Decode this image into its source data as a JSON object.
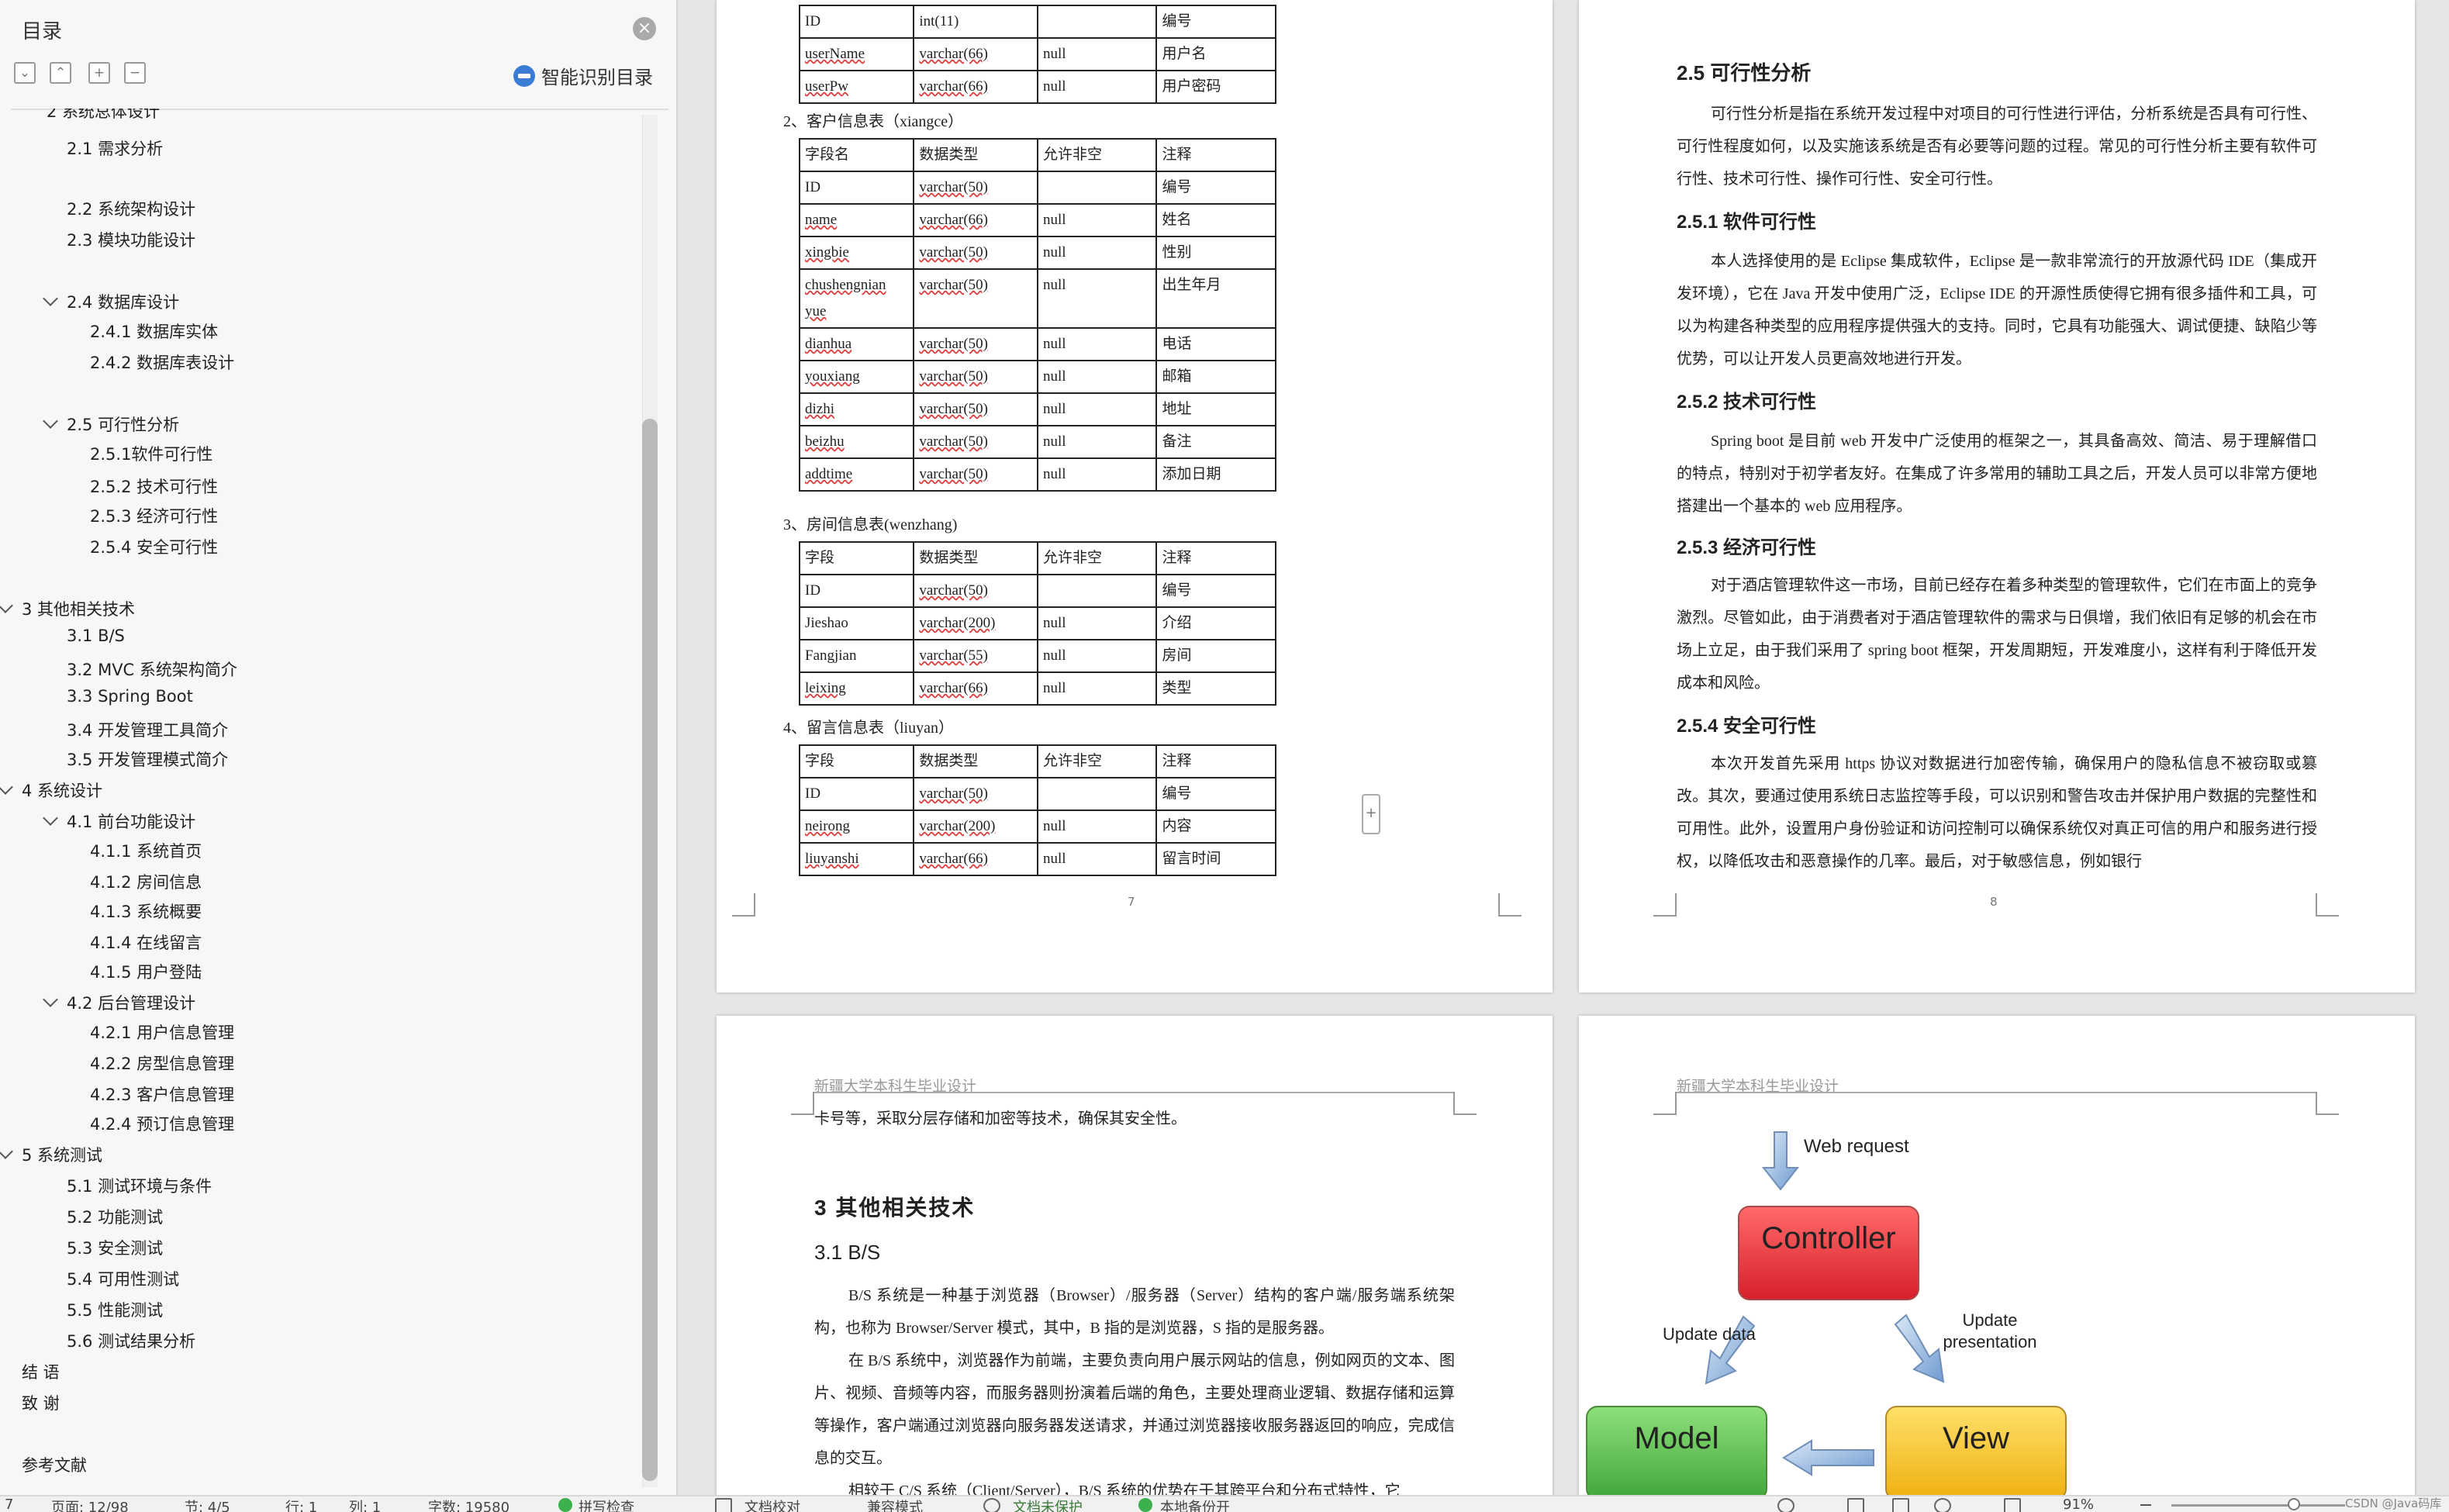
{
  "toc": {
    "title": "目录",
    "smart_label": "智能识别目录",
    "items": [
      {
        "label": "2.1 需求分析",
        "level": 1
      },
      {
        "label": "2.2 系统架构设计",
        "level": 1
      },
      {
        "label": "2.3 模块功能设计",
        "level": 1
      },
      {
        "label": "2.4 数据库设计",
        "level": 1,
        "expanded": true
      },
      {
        "label": "2.4.1 数据库实体",
        "level": 2
      },
      {
        "label": "2.4.2 数据库表设计",
        "level": 2
      },
      {
        "label": "2.5 可行性分析",
        "level": 1,
        "expanded": true
      },
      {
        "label": "2.5.1软件可行性",
        "level": 2
      },
      {
        "label": "2.5.2 技术可行性",
        "level": 2
      },
      {
        "label": "2.5.3 经济可行性",
        "level": 2
      },
      {
        "label": "2.5.4 安全可行性",
        "level": 2
      },
      {
        "label": "3 其他相关技术",
        "level": 0,
        "expanded": true
      },
      {
        "label": "3.1 B/S",
        "level": 1
      },
      {
        "label": "3.2 MVC 系统架构简介",
        "level": 1
      },
      {
        "label": "3.3 Spring Boot",
        "level": 1
      },
      {
        "label": "3.4 开发管理工具简介",
        "level": 1
      },
      {
        "label": "3.5 开发管理模式简介",
        "level": 1
      },
      {
        "label": "4 系统设计",
        "level": 0,
        "expanded": true
      },
      {
        "label": "4.1 前台功能设计",
        "level": 1,
        "expanded": true
      },
      {
        "label": "4.1.1 系统首页",
        "level": 2
      },
      {
        "label": "4.1.2 房间信息",
        "level": 2
      },
      {
        "label": "4.1.3 系统概要",
        "level": 2
      },
      {
        "label": "4.1.4 在线留言",
        "level": 2
      },
      {
        "label": "4.1.5 用户登陆",
        "level": 2
      },
      {
        "label": "4.2 后台管理设计",
        "level": 1,
        "expanded": true
      },
      {
        "label": "4.2.1 用户信息管理",
        "level": 2
      },
      {
        "label": "4.2.2 房型信息管理",
        "level": 2
      },
      {
        "label": "4.2.3 客户信息管理",
        "level": 2
      },
      {
        "label": "4.2.4 预订信息管理",
        "level": 2
      },
      {
        "label": "5 系统测试",
        "level": 0,
        "expanded": true
      },
      {
        "label": "5.1 测试环境与条件",
        "level": 1
      },
      {
        "label": "5.2 功能测试",
        "level": 1
      },
      {
        "label": "5.3 安全测试",
        "level": 1
      },
      {
        "label": "5.4 可用性测试",
        "level": 1
      },
      {
        "label": "5.5 性能测试",
        "level": 1
      },
      {
        "label": "5.6 测试结果分析",
        "level": 1
      },
      {
        "label": "结 语",
        "level": 0
      },
      {
        "label": "致 谢",
        "level": 0
      },
      {
        "label": "参考文献",
        "level": 0
      }
    ]
  },
  "page7": {
    "table1_rows": [
      [
        "ID",
        "int(11)",
        "",
        "编号"
      ],
      [
        "userName",
        "varchar(66)",
        "null",
        "用户名"
      ],
      [
        "userPw",
        "varchar(66)",
        "null",
        "用户密码"
      ]
    ],
    "cap2": "2、客户信息表（xiangce）",
    "table2_rows": [
      [
        "字段名",
        "数据类型",
        "允许非空",
        "注释"
      ],
      [
        "ID",
        "varchar(50)",
        "",
        "编号"
      ],
      [
        "name",
        "varchar(66)",
        "null",
        "姓名"
      ],
      [
        "xingbie",
        "varchar(50)",
        "null",
        "性别"
      ],
      [
        "chushengnian yue",
        "varchar(50)",
        "null",
        "出生年月"
      ],
      [
        "dianhua",
        "varchar(50)",
        "null",
        "电话"
      ],
      [
        "youxiang",
        "varchar(50)",
        "null",
        "邮箱"
      ],
      [
        "dizhi",
        "varchar(50)",
        "null",
        "地址"
      ],
      [
        "beizhu",
        "varchar(50)",
        "null",
        "备注"
      ],
      [
        "addtime",
        "varchar(50)",
        "null",
        "添加日期"
      ]
    ],
    "cap3": "3、房间信息表(wenzhang)",
    "table3_rows": [
      [
        "字段",
        "数据类型",
        "允许非空",
        "注释"
      ],
      [
        "ID",
        "varchar(50)",
        "",
        "编号"
      ],
      [
        "Jieshao",
        "varchar(200)",
        "null",
        "介绍"
      ],
      [
        "Fangjian",
        "varchar(55)",
        "null",
        "房间"
      ],
      [
        "leixing",
        "varchar(66)",
        "null",
        "类型"
      ]
    ],
    "cap4": "4、留言信息表（liuyan）",
    "table4_rows": [
      [
        "字段",
        "数据类型",
        "允许非空",
        "注释"
      ],
      [
        "ID",
        "varchar(50)",
        "",
        "编号"
      ],
      [
        "neirong",
        "varchar(200)",
        "null",
        "内容"
      ],
      [
        "liuyanshi",
        "varchar(66)",
        "null",
        "留言时间"
      ]
    ],
    "page_number": "7"
  },
  "page8": {
    "h_25": "2.5  可行性分析",
    "p_25": "可行性分析是指在系统开发过程中对项目的可行性进行评估，分析系统是否具有可行性、可行性程度如何，以及实施该系统是否有必要等问题的过程。常见的可行性分析主要有软件可行性、技术可行性、操作可行性、安全可行性。",
    "h_251": "2.5.1 软件可行性",
    "p_251": "本人选择使用的是 Eclipse 集成软件，Eclipse 是一款非常流行的开放源代码 IDE（集成开发环境），它在 Java 开发中使用广泛，Eclipse IDE 的开源性质使得它拥有很多插件和工具，可以为构建各种类型的应用程序提供强大的支持。同时，它具有功能强大、调试便捷、缺陷少等优势，可以让开发人员更高效地进行开发。",
    "h_252": "2.5.2 技术可行性",
    "p_252": "Spring boot 是目前 web 开发中广泛使用的框架之一，其具备高效、简洁、易于理解借口的特点，特别对于初学者友好。在集成了许多常用的辅助工具之后，开发人员可以非常方便地搭建出一个基本的 web 应用程序。",
    "h_253": "2.5.3 经济可行性",
    "p_253": "对于酒店管理软件这一市场，目前已经存在着多种类型的管理软件，它们在市面上的竞争激烈。尽管如此，由于消费者对于酒店管理软件的需求与日俱增，我们依旧有足够的机会在市场上立足，由于我们采用了 spring boot 框架，开发周期短，开发难度小，这样有利于降低开发成本和风险。",
    "h_254": "2.5.4 安全可行性",
    "p_254": "本次开发首先采用 https 协议对数据进行加密传输，确保用户的隐私信息不被窃取或篡改。其次，要通过使用系统日志监控等手段，可以识别和警告攻击并保护用户数据的完整性和可用性。此外，设置用户身份验证和访问控制可以确保系统仅对真正可信的用户和服务进行授权，以降低攻击和恶意操作的几率。最后，对于敏感信息，例如银行",
    "page_number": "8"
  },
  "page9": {
    "header": "新疆大学本科生毕业设计",
    "p_cont": "卡号等，采取分层存储和加密等技术，确保其安全性。",
    "h_3": "3  其他相关技术",
    "h_31": "3.1  B/S",
    "p_31a": "B/S 系统是一种基于浏览器（Browser）/服务器（Server）结构的客户端/服务端系统架构，也称为 Browser/Server 模式，其中，B 指的是浏览器，S 指的是服务器。",
    "p_31b": "在 B/S 系统中，浏览器作为前端，主要负责向用户展示网站的信息，例如网页的文本、图片、视频、音频等内容，而服务器则扮演着后端的角色，主要处理商业逻辑、数据存储和运算等操作，客户端通过浏览器向服务器发送请求，并通过浏览器接收服务器返回的响应，完成信息的交互。",
    "p_31c": "相较于 C/S 系统（Client/Server），B/S 系统的优势在于其跨平台和分布式特性，它"
  },
  "page10": {
    "header": "新疆大学本科生毕业设计",
    "web_request": "Web request",
    "controller": "Controller",
    "model": "Model",
    "view": "View",
    "update_data": "Update data",
    "update_presentation": "Update presentation"
  },
  "status": {
    "page": "页面: 12/98",
    "section": "节: 4/5",
    "row": "行: 1",
    "col": "列: 1",
    "words": "字数: 19580",
    "spell": "拼写检查",
    "doc_check": "文档校对",
    "compat": "兼容模式",
    "protect": "文档未保护",
    "backup": "本地备份开",
    "zoom": "91%",
    "watermark": "CSDN @Java码库"
  },
  "colors": {
    "controller": "#e8323a",
    "model": "#58b84a",
    "view": "#f2c12a",
    "arrow": "#7fa7d3",
    "accent": "#3a7bd5"
  }
}
